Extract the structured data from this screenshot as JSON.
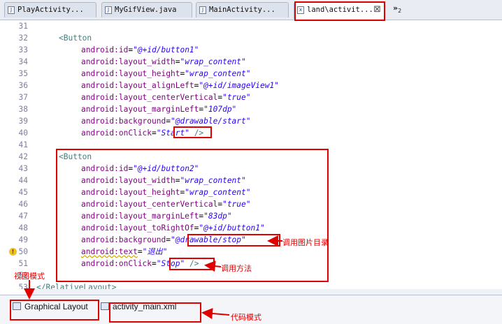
{
  "tabs": [
    {
      "label": "PlayActivity...",
      "icon": "java-file-icon"
    },
    {
      "label": "MyGifView.java",
      "icon": "java-file-icon"
    },
    {
      "label": "MainActivity...",
      "icon": "java-file-icon"
    },
    {
      "label": "land\\activit...",
      "icon": "xml-file-icon",
      "active": true
    }
  ],
  "tab_overflow": {
    "symbol": "»",
    "count": "2"
  },
  "code_lines": [
    {
      "num": "31",
      "tokens": []
    },
    {
      "num": "32",
      "tokens": [
        {
          "t": "tag",
          "v": "<Button"
        }
      ]
    },
    {
      "num": "33",
      "tokens": [
        {
          "t": "attr",
          "v": "android:id"
        },
        {
          "t": "eq",
          "v": "="
        },
        {
          "t": "val",
          "v": "\"@+id/button1\""
        }
      ]
    },
    {
      "num": "34",
      "tokens": [
        {
          "t": "attr",
          "v": "android:layout_width"
        },
        {
          "t": "eq",
          "v": "="
        },
        {
          "t": "val",
          "v": "\"wrap_content\""
        }
      ]
    },
    {
      "num": "35",
      "tokens": [
        {
          "t": "attr",
          "v": "android:layout_height"
        },
        {
          "t": "eq",
          "v": "="
        },
        {
          "t": "val",
          "v": "\"wrap_content\""
        }
      ]
    },
    {
      "num": "36",
      "tokens": [
        {
          "t": "attr",
          "v": "android:layout_alignLeft"
        },
        {
          "t": "eq",
          "v": "="
        },
        {
          "t": "val",
          "v": "\"@+id/imageView1\""
        }
      ]
    },
    {
      "num": "37",
      "tokens": [
        {
          "t": "attr",
          "v": "android:layout_centerVertical"
        },
        {
          "t": "eq",
          "v": "="
        },
        {
          "t": "val",
          "v": "\"true\""
        }
      ]
    },
    {
      "num": "38",
      "tokens": [
        {
          "t": "attr",
          "v": "android:layout_marginLeft"
        },
        {
          "t": "eq",
          "v": "="
        },
        {
          "t": "val",
          "v": "\"107dp\""
        }
      ]
    },
    {
      "num": "39",
      "tokens": [
        {
          "t": "attr",
          "v": "android:background"
        },
        {
          "t": "eq",
          "v": "="
        },
        {
          "t": "val",
          "v": "\"@drawable/start\""
        }
      ]
    },
    {
      "num": "40",
      "tokens": [
        {
          "t": "attr",
          "v": "android:onClick"
        },
        {
          "t": "eq",
          "v": "="
        },
        {
          "t": "val",
          "v": "\"Start\""
        },
        {
          "t": "tag",
          "v": " />"
        }
      ]
    },
    {
      "num": "41",
      "tokens": []
    },
    {
      "num": "42",
      "tokens": [
        {
          "t": "tag",
          "v": "<Button"
        }
      ]
    },
    {
      "num": "43",
      "tokens": [
        {
          "t": "attr",
          "v": "android:id"
        },
        {
          "t": "eq",
          "v": "="
        },
        {
          "t": "val",
          "v": "\"@+id/button2\""
        }
      ]
    },
    {
      "num": "44",
      "tokens": [
        {
          "t": "attr",
          "v": "android:layout_width"
        },
        {
          "t": "eq",
          "v": "="
        },
        {
          "t": "val",
          "v": "\"wrap_content\""
        }
      ]
    },
    {
      "num": "45",
      "tokens": [
        {
          "t": "attr",
          "v": "android:layout_height"
        },
        {
          "t": "eq",
          "v": "="
        },
        {
          "t": "val",
          "v": "\"wrap_content\""
        }
      ]
    },
    {
      "num": "46",
      "tokens": [
        {
          "t": "attr",
          "v": "android:layout_centerVertical"
        },
        {
          "t": "eq",
          "v": "="
        },
        {
          "t": "val",
          "v": "\"true\""
        }
      ]
    },
    {
      "num": "47",
      "tokens": [
        {
          "t": "attr",
          "v": "android:layout_marginLeft"
        },
        {
          "t": "eq",
          "v": "="
        },
        {
          "t": "val",
          "v": "\"83dp\""
        }
      ]
    },
    {
      "num": "48",
      "tokens": [
        {
          "t": "attr",
          "v": "android:layout_toRightOf"
        },
        {
          "t": "eq",
          "v": "="
        },
        {
          "t": "val",
          "v": "\"@+id/button1\""
        }
      ]
    },
    {
      "num": "49",
      "tokens": [
        {
          "t": "attr",
          "v": "android:background"
        },
        {
          "t": "eq",
          "v": "="
        },
        {
          "t": "val",
          "v": "\"@drawable/stop\""
        }
      ]
    },
    {
      "num": "50",
      "tokens": [
        {
          "t": "attr",
          "v": "android:text"
        },
        {
          "t": "eq",
          "v": "="
        },
        {
          "t": "val",
          "v": "\"退出\""
        }
      ],
      "warning": true
    },
    {
      "num": "51",
      "tokens": [
        {
          "t": "attr",
          "v": "android:onClick"
        },
        {
          "t": "eq",
          "v": "="
        },
        {
          "t": "val",
          "v": "\"Stop\""
        },
        {
          "t": "tag",
          "v": " />"
        }
      ]
    },
    {
      "num": "52",
      "tokens": []
    },
    {
      "num": "53",
      "tokens": [
        {
          "t": "tag",
          "v": "</RelativeLayout>"
        }
      ]
    }
  ],
  "bottom_tabs": [
    {
      "label": "Graphical Layout",
      "icon": "layout-icon",
      "active": true
    },
    {
      "label": "activity_main.xml",
      "icon": "xml-file-icon"
    }
  ],
  "annotations": {
    "image_dir": "调用图片目录",
    "call_method": "调用方法",
    "view_mode": "视图模式",
    "code_mode": "代码模式"
  },
  "colors": {
    "annotation_red": "#e00000",
    "tag": "#3f7f7f",
    "attribute": "#7f007f",
    "value": "#2a00ff",
    "line_number": "#7f7f9f"
  }
}
